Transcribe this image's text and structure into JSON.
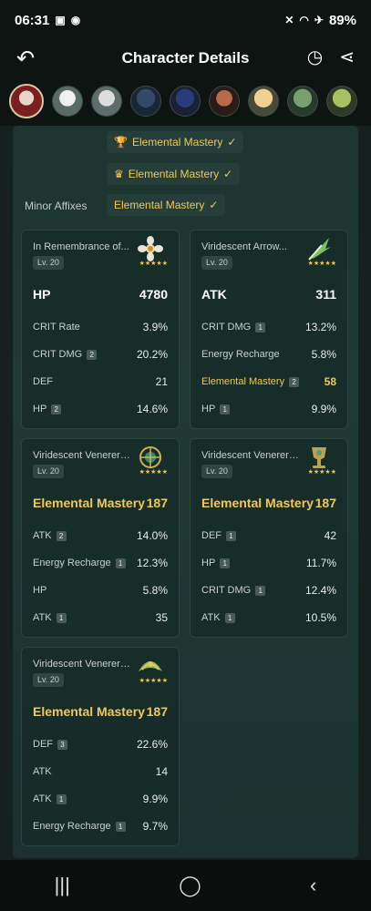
{
  "status_bar": {
    "time": "06:31",
    "battery": "89%"
  },
  "header": {
    "title": "Character Details"
  },
  "affix_chips": [
    "Elemental Mastery",
    "Elemental Mastery",
    "Elemental Mastery"
  ],
  "minor_affixes_label": "Minor Affixes",
  "cards": [
    {
      "name": "In Remembrance of...",
      "level": "Lv. 20",
      "stars": "★★★★★",
      "main_label": "HP",
      "main_value": "4780",
      "stats": [
        {
          "label": "CRIT Rate",
          "count": "",
          "value": "3.9%"
        },
        {
          "label": "CRIT DMG",
          "count": "2",
          "value": "20.2%"
        },
        {
          "label": "DEF",
          "count": "",
          "value": "21"
        },
        {
          "label": "HP",
          "count": "2",
          "value": "14.6%"
        }
      ]
    },
    {
      "name": "Viridescent Arrow...",
      "level": "Lv. 20",
      "stars": "★★★★★",
      "main_label": "ATK",
      "main_value": "311",
      "stats": [
        {
          "label": "CRIT DMG",
          "count": "1",
          "value": "13.2%"
        },
        {
          "label": "Energy Recharge",
          "count": "",
          "value": "5.8%"
        },
        {
          "label": "Elemental Mastery",
          "count": "2",
          "value": "58"
        },
        {
          "label": "HP",
          "count": "1",
          "value": "9.9%"
        }
      ]
    },
    {
      "name": "Viridescent Venerer's...",
      "level": "Lv. 20",
      "stars": "★★★★★",
      "main_label": "Elemental Mastery",
      "main_value": "187",
      "stats": [
        {
          "label": "ATK",
          "count": "2",
          "value": "14.0%"
        },
        {
          "label": "Energy Recharge",
          "count": "1",
          "value": "12.3%"
        },
        {
          "label": "HP",
          "count": "",
          "value": "5.8%"
        },
        {
          "label": "ATK",
          "count": "1",
          "value": "35"
        }
      ]
    },
    {
      "name": "Viridescent Venerer's...",
      "level": "Lv. 20",
      "stars": "★★★★★",
      "main_label": "Elemental Mastery",
      "main_value": "187",
      "stats": [
        {
          "label": "DEF",
          "count": "1",
          "value": "42"
        },
        {
          "label": "HP",
          "count": "1",
          "value": "11.7%"
        },
        {
          "label": "CRIT DMG",
          "count": "1",
          "value": "12.4%"
        },
        {
          "label": "ATK",
          "count": "1",
          "value": "10.5%"
        }
      ]
    },
    {
      "name": "Viridescent Venerer's...",
      "level": "Lv. 20",
      "stars": "★★★★★",
      "main_label": "Elemental Mastery",
      "main_value": "187",
      "stats": [
        {
          "label": "DEF",
          "count": "3",
          "value": "22.6%"
        },
        {
          "label": "ATK",
          "count": "",
          "value": "14"
        },
        {
          "label": "ATK",
          "count": "1",
          "value": "9.9%"
        },
        {
          "label": "Energy Recharge",
          "count": "1",
          "value": "9.7%"
        }
      ]
    }
  ],
  "colors": {
    "accent_gold": "#f0c858",
    "panel": "#203a35",
    "bar": "#0d1412"
  },
  "icons": [
    "back-icon",
    "history-icon",
    "share-icon",
    "recents-icon",
    "home-icon",
    "back-nav-icon"
  ]
}
